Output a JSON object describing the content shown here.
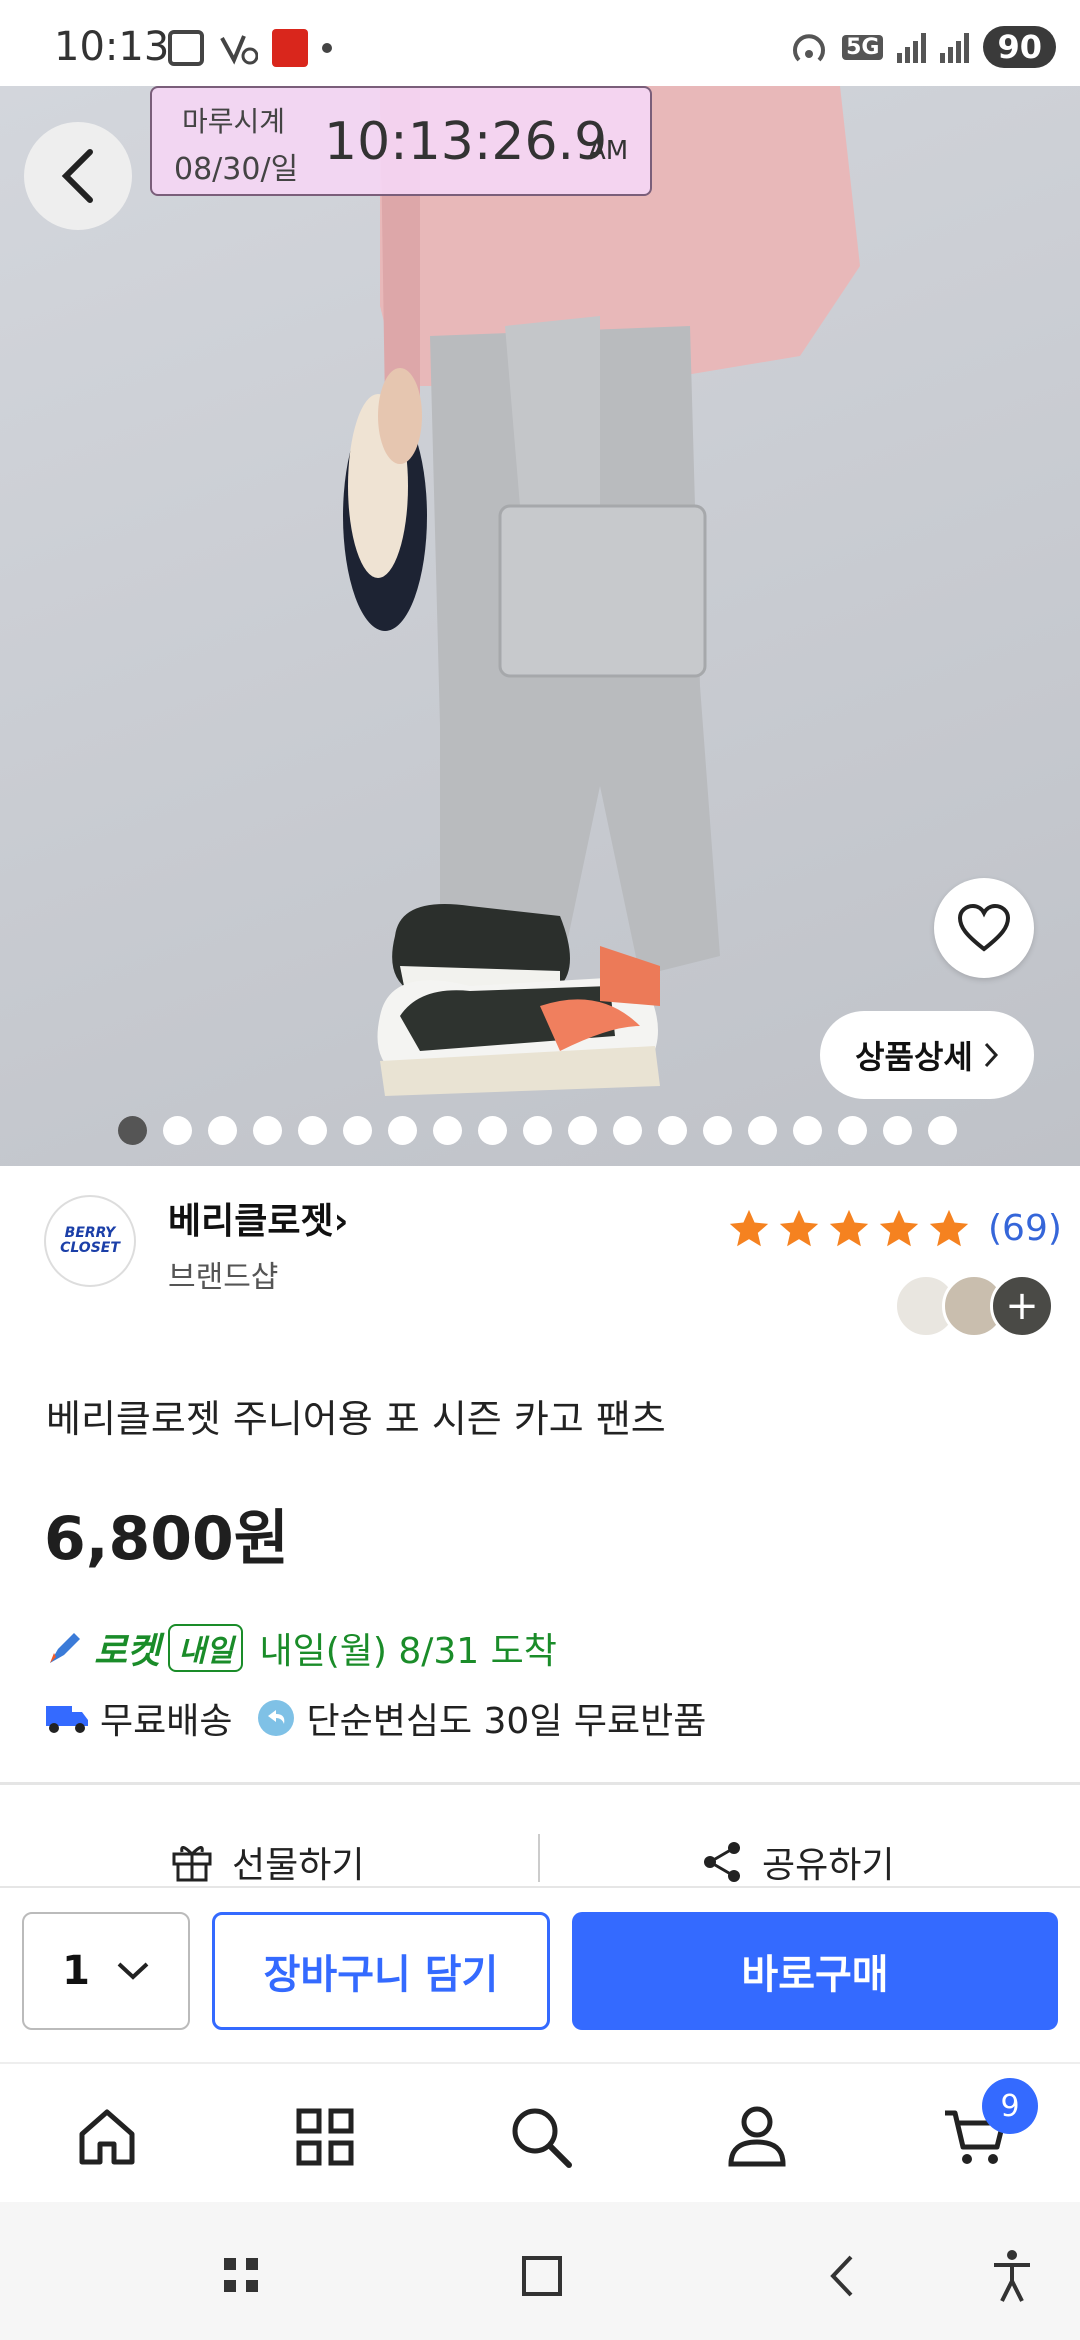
{
  "status": {
    "time": "10:13",
    "network": "5G",
    "battery": "90"
  },
  "clock_overlay": {
    "app_name": "마루시계",
    "date": "08/30/일",
    "time": "10:13:26.9",
    "ampm": "AM"
  },
  "hero": {
    "detail_button": "상품상세",
    "image_count": 19,
    "active_index": 0
  },
  "seller": {
    "logo_text_1": "BERRY",
    "logo_text_2": "CLOSET",
    "name": "베리클로젯",
    "subtitle": "브랜드샵"
  },
  "rating": {
    "stars": 5,
    "count_text": "(69)",
    "star_color": "#f58220"
  },
  "product": {
    "title": "베리클로젯 주니어용 포 시즌 카고 팬츠",
    "price": "6,800원"
  },
  "delivery": {
    "rocket_label": "로켓",
    "rocket_badge": "내일",
    "arrival": "내일(월) 8/31 도착",
    "free_shipping": "무료배송",
    "free_return": "단순변심도 30일 무료반품",
    "accent_color": "#1a8c29"
  },
  "actions": {
    "gift": "선물하기",
    "share": "공유하기"
  },
  "buybar": {
    "quantity": "1",
    "add_to_cart": "장바구니 담기",
    "buy_now": "바로구매",
    "accent_color": "#346aff"
  },
  "bottom_nav": {
    "items": [
      "home-icon",
      "category-icon",
      "search-icon",
      "account-icon",
      "cart-icon"
    ],
    "cart_count": "9"
  }
}
